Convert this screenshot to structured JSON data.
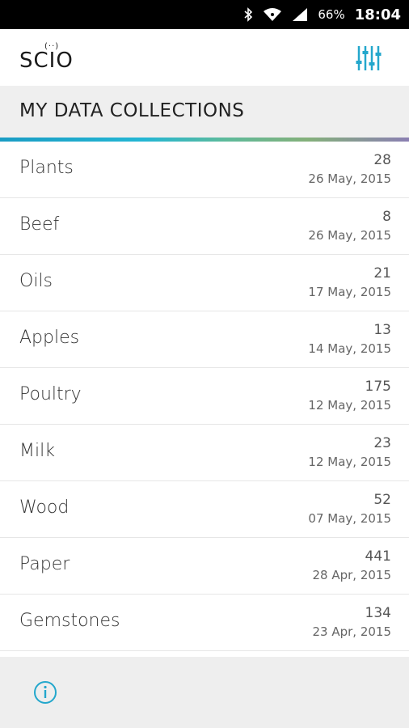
{
  "status_bar": {
    "icons": [
      "bluetooth-icon",
      "wifi-icon",
      "cell-signal-icon"
    ],
    "battery": "66%",
    "time": "18:04"
  },
  "app_bar": {
    "logo_text": "SCIO",
    "logo_dots": "(··)",
    "filter_icon": "sliders-icon"
  },
  "header": {
    "title": "MY DATA COLLECTIONS"
  },
  "colors": {
    "accent": "#1a9cc4",
    "gradient": [
      "#1a9cc4",
      "#23b6d4",
      "#5dba9b",
      "#84b07a",
      "#8b7fb2"
    ]
  },
  "collections": [
    {
      "name": "Plants",
      "count": "28",
      "date": "26 May, 2015"
    },
    {
      "name": "Beef",
      "count": "8",
      "date": "26 May, 2015"
    },
    {
      "name": "Oils",
      "count": "21",
      "date": "17 May, 2015"
    },
    {
      "name": "Apples",
      "count": "13",
      "date": "14 May, 2015"
    },
    {
      "name": "Poultry",
      "count": "175",
      "date": "12 May, 2015"
    },
    {
      "name": "Milk",
      "count": "23",
      "date": "12 May, 2015"
    },
    {
      "name": "Wood",
      "count": "52",
      "date": "07 May, 2015"
    },
    {
      "name": "Paper",
      "count": "441",
      "date": "28 Apr, 2015"
    },
    {
      "name": "Gemstones",
      "count": "134",
      "date": "23 Apr, 2015"
    }
  ],
  "footer": {
    "info_icon": "info-icon"
  }
}
